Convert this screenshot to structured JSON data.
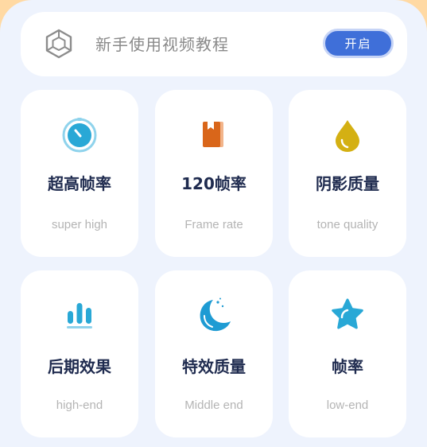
{
  "banner": {
    "icon": "cube-icon",
    "text": "新手使用视频教程",
    "button_label": "开启"
  },
  "colors": {
    "accent": "#3f6fd9",
    "background": "#eef3fd",
    "title": "#1f2b4f",
    "subtitle": "#b4b4b4"
  },
  "cards": [
    {
      "title": "超高帧率",
      "subtitle": "super high",
      "icon": "timer-icon",
      "color": "#29a8d6"
    },
    {
      "title": "120帧率",
      "subtitle": "Frame rate",
      "icon": "book-icon",
      "color": "#d9661a"
    },
    {
      "title": "阴影质量",
      "subtitle": "tone quality",
      "icon": "drop-icon",
      "color": "#d4b013"
    },
    {
      "title": "后期效果",
      "subtitle": "high-end",
      "icon": "bar-chart-icon",
      "color": "#29a8d6"
    },
    {
      "title": "特效质量",
      "subtitle": "Middle end",
      "icon": "moon-icon",
      "color": "#1e9bd3"
    },
    {
      "title": "帧率",
      "subtitle": "low-end",
      "icon": "star-icon",
      "color": "#29a8d6"
    }
  ]
}
